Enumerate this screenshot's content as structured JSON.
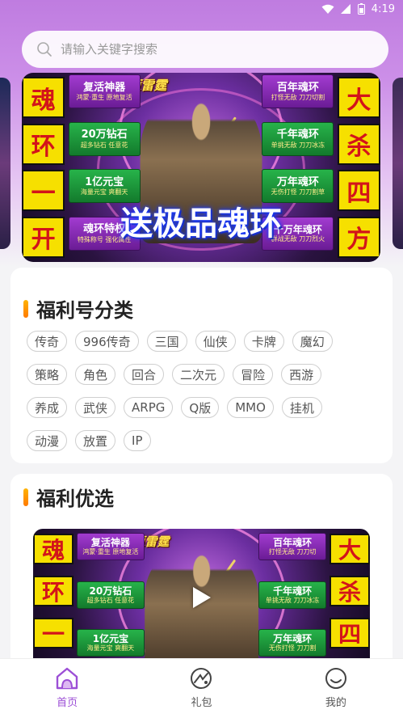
{
  "status_bar": {
    "time": "4:19"
  },
  "search": {
    "placeholder": "请输入关键字搜索"
  },
  "banner": {
    "logo": "永恒雷霆",
    "slogan": "送极品魂环",
    "left_chars": [
      "魂",
      "环",
      "一",
      "开"
    ],
    "right_chars": [
      "大",
      "杀",
      "四",
      "方"
    ],
    "left_tags": [
      {
        "title": "复活神器",
        "sub": "鸿蒙·重生 原地复活"
      },
      {
        "title": "20万钻石",
        "sub": "超多钻石 任意花"
      },
      {
        "title": "1亿元宝",
        "sub": "海量元宝 爽翻天"
      },
      {
        "title": "魂环特权",
        "sub": "特殊称号 强化属性"
      }
    ],
    "right_tags": [
      {
        "title": "百年魂环",
        "sub": "打怪无敌 刀刀切割"
      },
      {
        "title": "千年魂环",
        "sub": "单挑无敌 刀刀冰冻"
      },
      {
        "title": "万年魂环",
        "sub": "无伤打怪 刀刀割草"
      },
      {
        "title": "十万年魂环",
        "sub": "群战无敌 刀刀烈火"
      }
    ]
  },
  "welfare_category": {
    "title": "福利号分类",
    "chips": [
      "传奇",
      "996传奇",
      "三国",
      "仙侠",
      "卡牌",
      "魔幻",
      "策略",
      "角色",
      "回合",
      "二次元",
      "冒险",
      "西游",
      "养成",
      "武侠",
      "ARPG",
      "Q版",
      "MMO",
      "挂机",
      "动漫",
      "放置",
      "IP"
    ]
  },
  "welfare_pick": {
    "title": "福利优选",
    "video": {
      "logo": "永恒雷霆",
      "left_chars": [
        "魂",
        "环",
        "一"
      ],
      "right_chars": [
        "大",
        "杀",
        "四"
      ],
      "left_tags": [
        {
          "title": "复活神器",
          "sub": "鸿蒙·重生 原地复活"
        },
        {
          "title": "20万钻石",
          "sub": "超多钻石 任意花"
        },
        {
          "title": "1亿元宝",
          "sub": "海量元宝 爽翻天"
        }
      ],
      "right_tags": [
        {
          "title": "百年魂环",
          "sub": "打怪无敌 刀刀切"
        },
        {
          "title": "千年魂环",
          "sub": "单挑无敌 刀刀冰冻"
        },
        {
          "title": "万年魂环",
          "sub": "无伤打怪 刀刀割"
        }
      ]
    }
  },
  "tabbar": {
    "items": [
      {
        "label": "首页",
        "icon": "home-icon",
        "active": true
      },
      {
        "label": "礼包",
        "icon": "gift-icon",
        "active": false
      },
      {
        "label": "我的",
        "icon": "profile-icon",
        "active": false
      }
    ]
  },
  "colors": {
    "accent": "#9c4fd6",
    "title_bar": "#ff9000",
    "header_top": "#bf7ce0"
  }
}
